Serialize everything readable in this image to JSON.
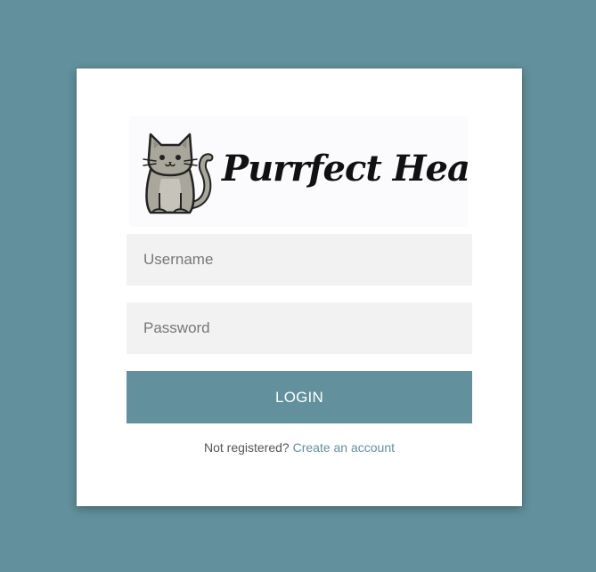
{
  "logo": {
    "brand_text": "Purrfect Health",
    "icon": "cat-icon"
  },
  "form": {
    "username_placeholder": "Username",
    "password_placeholder": "Password",
    "login_label": "LOGIN",
    "not_registered_text": "Not registered?",
    "create_account_link": "Create an account"
  },
  "colors": {
    "page_background": "#62909c",
    "card_background": "#ffffff",
    "input_background": "#f2f2f2",
    "button_background": "#62909c",
    "link_color": "#62909c"
  }
}
